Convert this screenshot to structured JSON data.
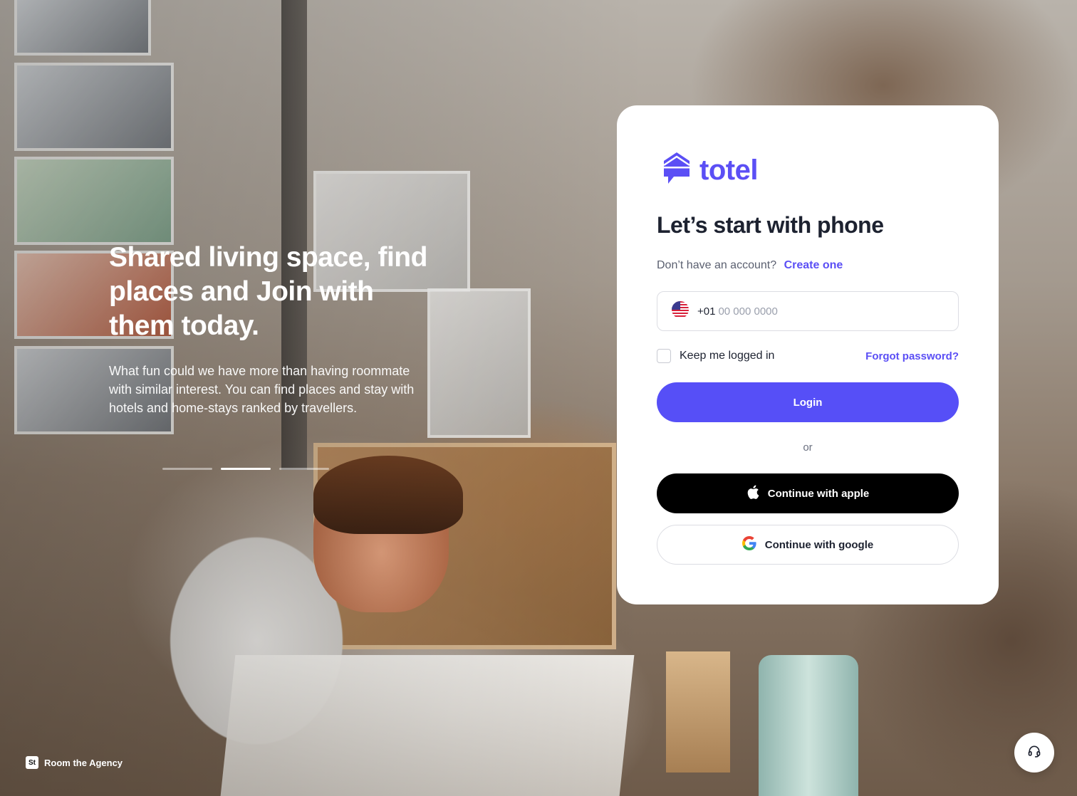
{
  "hero": {
    "headline": "Shared living space, find places and Join with them today.",
    "description": "What fun could we have more than having roommate with similar interest. You can find places and stay with hotels and home-stays ranked by travellers.",
    "carousel": {
      "slides": 3,
      "active_index": 1
    }
  },
  "footer": {
    "agency_logo": "St",
    "agency_label": "Room the Agency"
  },
  "support": {
    "icon": "headset-icon"
  },
  "card": {
    "brand": {
      "name": "totel",
      "color": "#5b4ff5",
      "icon": "house-chat-icon"
    },
    "title": "Let’s start with phone",
    "signup_prompt": "Don’t have an account?",
    "signup_link": "Create one",
    "phone": {
      "flag": "us-flag-icon",
      "country_code": "+01",
      "placeholder": "00 000 0000",
      "value": ""
    },
    "remember_label": "Keep me logged in",
    "remember_checked": false,
    "forgot_link": "Forgot password?",
    "login_label": "Login",
    "login_color": "#564ff7",
    "or_label": "or",
    "apple_label": "Continue with apple",
    "google_label": "Continue with google"
  }
}
